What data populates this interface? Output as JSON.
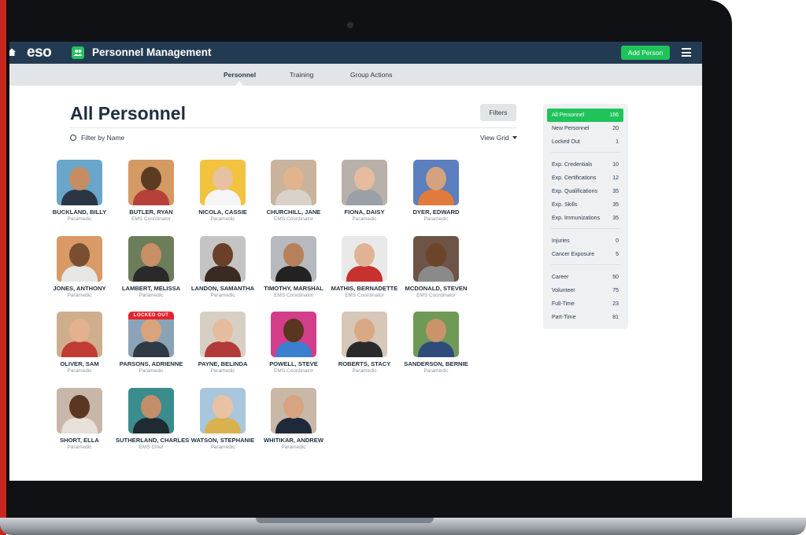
{
  "header": {
    "logo": "eso",
    "title": "Personnel Management",
    "add_button": "Add Person"
  },
  "tabs": [
    {
      "label": "Personnel",
      "active": true
    },
    {
      "label": "Training",
      "active": false
    },
    {
      "label": "Group Actions",
      "active": false
    }
  ],
  "main": {
    "title": "All Personnel",
    "filters_button": "Filters",
    "filter_by_name": "Filter by Name",
    "view_mode": "View Grid"
  },
  "personnel": [
    {
      "name": "BUCKLAND, BILLY",
      "role": "Paramedic",
      "bg": "#6aa6c9",
      "skin": "#c78d62",
      "shirt": "#2b3645"
    },
    {
      "name": "BUTLER, RYAN",
      "role": "EMS Coordinator",
      "bg": "#d49a64",
      "skin": "#5c3b23",
      "shirt": "#b5413a"
    },
    {
      "name": "NICOLA, CASSIE",
      "role": "Paramedic",
      "bg": "#f2c33e",
      "skin": "#e8c1a0",
      "shirt": "#f5f5f5"
    },
    {
      "name": "CHURCHILL, JANE",
      "role": "EMS Coordinator",
      "bg": "#c9b39c",
      "skin": "#e2b48d",
      "shirt": "#d9d2c8"
    },
    {
      "name": "FIONA, DAISY",
      "role": "Paramedic",
      "bg": "#b8b1aa",
      "skin": "#e6bba0",
      "shirt": "#9aa0a6"
    },
    {
      "name": "DYER, EDWARD",
      "role": "Paramedic",
      "bg": "#5b7fbf",
      "skin": "#d4a27c",
      "shirt": "#e07a3d"
    },
    {
      "name": "JONES, ANTHONY",
      "role": "Paramedic",
      "bg": "#d99a65",
      "skin": "#7a4f31",
      "shirt": "#e6e6e6"
    },
    {
      "name": "LAMBERT, MELISSA",
      "role": "Paramedic",
      "bg": "#6c7d5a",
      "skin": "#c98f66",
      "shirt": "#2a2a2a"
    },
    {
      "name": "LANDON, SAMANTHA",
      "role": "Paramedic",
      "bg": "#c4c4c4",
      "skin": "#6b4028",
      "shirt": "#3b2a22"
    },
    {
      "name": "TIMOTHY, MARSHAL",
      "role": "EMS Coordinator",
      "bg": "#b6b9bd",
      "skin": "#b5805a",
      "shirt": "#222222"
    },
    {
      "name": "MATHIS, BERNADETTE",
      "role": "EMS Coordinator",
      "bg": "#e9e9e9",
      "skin": "#e0b394",
      "shirt": "#c7312e"
    },
    {
      "name": "MCDONALD, STEVEN",
      "role": "EMS Coordinator",
      "bg": "#6e5447",
      "skin": "#6b4429",
      "shirt": "#8a8a8a"
    },
    {
      "name": "OLIVER, SAM",
      "role": "Paramedic",
      "bg": "#cfae8e",
      "skin": "#e3b28c",
      "shirt": "#c13c33"
    },
    {
      "name": "PARSONS, ADRIENNE",
      "role": "Paramedic",
      "bg": "#8aa3b6",
      "skin": "#d9a37c",
      "shirt": "#2f3a46",
      "locked": "LOCKED OUT"
    },
    {
      "name": "PAYNE, BELINDA",
      "role": "Paramedic",
      "bg": "#d8cfc4",
      "skin": "#e5bd9e",
      "shirt": "#b33a3a"
    },
    {
      "name": "POWELL, STEVE",
      "role": "EMS Coordinator",
      "bg": "#d23e8a",
      "skin": "#5a3520",
      "shirt": "#3a7fd0"
    },
    {
      "name": "ROBERTS, STACY",
      "role": "Paramedic",
      "bg": "#d6c7b8",
      "skin": "#d9a983",
      "shirt": "#2a2a2a"
    },
    {
      "name": "SANDERSON, BERNIE",
      "role": "Paramedic",
      "bg": "#6e9a55",
      "skin": "#c9936b",
      "shirt": "#2f4b7a"
    },
    {
      "name": "SHORT, ELLA",
      "role": "Paramedic",
      "bg": "#c7b7a8",
      "skin": "#5b3621",
      "shirt": "#e6e0d8"
    },
    {
      "name": "SUTHERLAND, CHARLES",
      "role": "EMS Chief",
      "bg": "#3b8c8c",
      "skin": "#c38f6a",
      "shirt": "#1f2b33"
    },
    {
      "name": "WATSON, STEPHANIE",
      "role": "Paramedic",
      "bg": "#a9c6dc",
      "skin": "#e8c2a2",
      "shirt": "#d9b24f"
    },
    {
      "name": "WHITIKAR, ANDREW",
      "role": "Paramedic",
      "bg": "#c9b8a8",
      "skin": "#d6a481",
      "shirt": "#1e2a3a"
    }
  ],
  "sidebar": {
    "groups": [
      [
        {
          "label": "All Personnel",
          "count": "186",
          "active": true
        },
        {
          "label": "New Personnel",
          "count": "20"
        },
        {
          "label": "Locked Out",
          "count": "1"
        }
      ],
      [
        {
          "label": "Exp. Credentials",
          "count": "10"
        },
        {
          "label": "Exp. Certifications",
          "count": "12"
        },
        {
          "label": "Exp. Qualifications",
          "count": "35"
        },
        {
          "label": "Exp. Skills",
          "count": "35"
        },
        {
          "label": "Exp. Immunizations",
          "count": "35"
        }
      ],
      [
        {
          "label": "Injuries",
          "count": "0"
        },
        {
          "label": "Cancer Exposure",
          "count": "5"
        }
      ],
      [
        {
          "label": "Career",
          "count": "50"
        },
        {
          "label": "Volunteer",
          "count": "75"
        },
        {
          "label": "Full-Time",
          "count": "23"
        },
        {
          "label": "Part-Time",
          "count": "81"
        }
      ]
    ]
  },
  "colors": {
    "header_bg": "#233b52",
    "accent_green": "#1fc35a",
    "locked_red": "#e8222b"
  }
}
